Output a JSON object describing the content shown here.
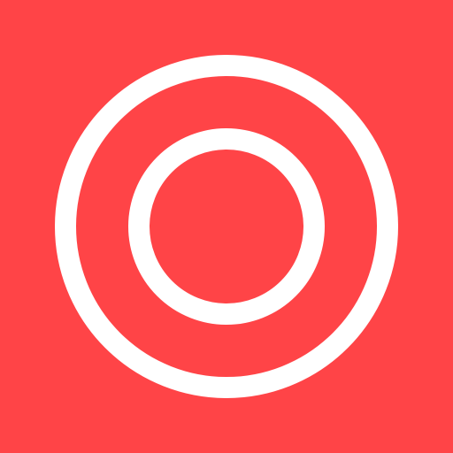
{
  "icon": {
    "name": "concentric-circles-icon",
    "shape": "two concentric rings",
    "colors": {
      "background": "#ff4447",
      "ring": "#ffffff"
    }
  }
}
